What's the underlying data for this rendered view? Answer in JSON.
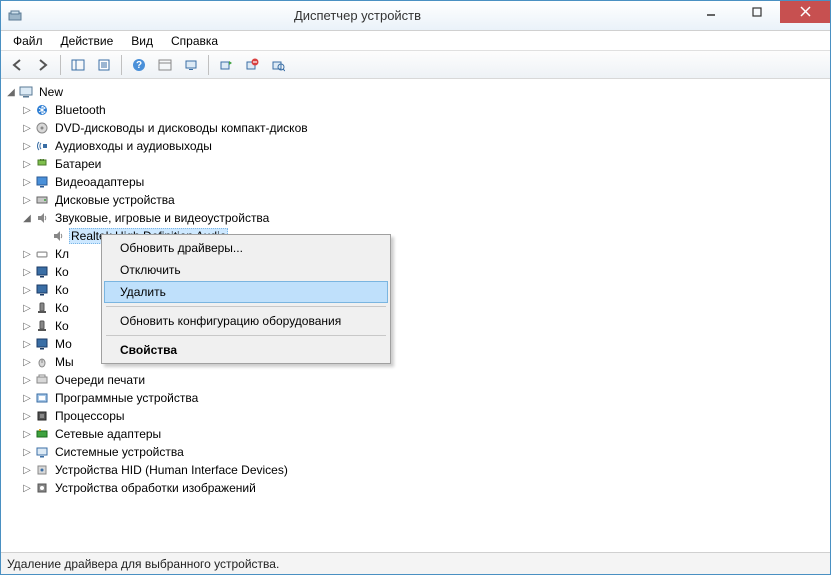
{
  "window": {
    "title": "Диспетчер устройств"
  },
  "menu": {
    "file": "Файл",
    "action": "Действие",
    "view": "Вид",
    "help": "Справка"
  },
  "tree": {
    "root": "New",
    "items": [
      {
        "label": "Bluetooth"
      },
      {
        "label": "DVD-дисководы и дисководы компакт-дисков"
      },
      {
        "label": "Аудиовходы и аудиовыходы"
      },
      {
        "label": "Батареи"
      },
      {
        "label": "Видеоадаптеры"
      },
      {
        "label": "Дисковые устройства"
      },
      {
        "label": "Звуковые, игровые и видеоустройства"
      },
      {
        "label": "Кл"
      },
      {
        "label": "Ко"
      },
      {
        "label": "Ко"
      },
      {
        "label": "Ко"
      },
      {
        "label": "Ко"
      },
      {
        "label": "Мо"
      },
      {
        "label": "Мы"
      },
      {
        "label": "Очереди печати"
      },
      {
        "label": "Программные устройства"
      },
      {
        "label": "Процессоры"
      },
      {
        "label": "Сетевые адаптеры"
      },
      {
        "label": "Системные устройства"
      },
      {
        "label": "Устройства HID (Human Interface Devices)"
      },
      {
        "label": "Устройства обработки изображений"
      }
    ],
    "selected_child": "Realtek High Definition Audio"
  },
  "context_menu": {
    "update": "Обновить драйверы...",
    "disable": "Отключить",
    "uninstall": "Удалить",
    "scan": "Обновить конфигурацию оборудования",
    "properties": "Свойства"
  },
  "status": {
    "text": "Удаление драйвера для выбранного устройства."
  }
}
